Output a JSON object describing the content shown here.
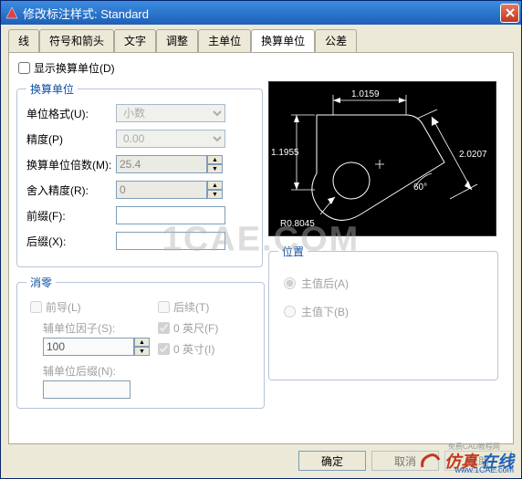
{
  "titlebar": {
    "title": "修改标注样式: Standard"
  },
  "tabs": {
    "items": [
      {
        "label": "线"
      },
      {
        "label": "符号和箭头"
      },
      {
        "label": "文字"
      },
      {
        "label": "调整"
      },
      {
        "label": "主单位"
      },
      {
        "label": "换算单位"
      },
      {
        "label": "公差"
      }
    ]
  },
  "showAlt": {
    "label": "显示换算单位(D)"
  },
  "altUnits": {
    "legend": "换算单位",
    "format": {
      "label": "单位格式(U):",
      "value": "小数"
    },
    "precision": {
      "label": "精度(P)",
      "value": "0.00"
    },
    "multiplier": {
      "label": "换算单位倍数(M):",
      "value": "25.4"
    },
    "roundoff": {
      "label": "舍入精度(R):",
      "value": "0"
    },
    "prefix": {
      "label": "前缀(F):",
      "value": ""
    },
    "suffix": {
      "label": "后缀(X):",
      "value": ""
    }
  },
  "suppress": {
    "legend": "消零",
    "leading": {
      "label": "前导(L)"
    },
    "trailing": {
      "label": "后续(T)"
    },
    "subfactor": {
      "label": "辅单位因子(S):",
      "value": "100"
    },
    "feet": {
      "label": "0 英尺(F)"
    },
    "inches": {
      "label": "0 英寸(I)"
    },
    "subSuffix": {
      "label": "辅单位后缀(N):",
      "value": ""
    }
  },
  "preview": {
    "dim1": "1.0159",
    "dim2": "1.1955",
    "dim3": "2.0207",
    "angle": "60°",
    "radius": "R0.8045"
  },
  "position": {
    "legend": "位置",
    "after": {
      "label": "主值后(A)"
    },
    "below": {
      "label": "主值下(B)"
    }
  },
  "buttons": {
    "ok": "确定",
    "cancel": "取消",
    "help": "帮助"
  },
  "brand": {
    "text1": "仿真",
    "text2": "在线",
    "url": "www.1CAE.com",
    "ext": "免费CAD教程网"
  },
  "watermark": "1CAE.COM"
}
